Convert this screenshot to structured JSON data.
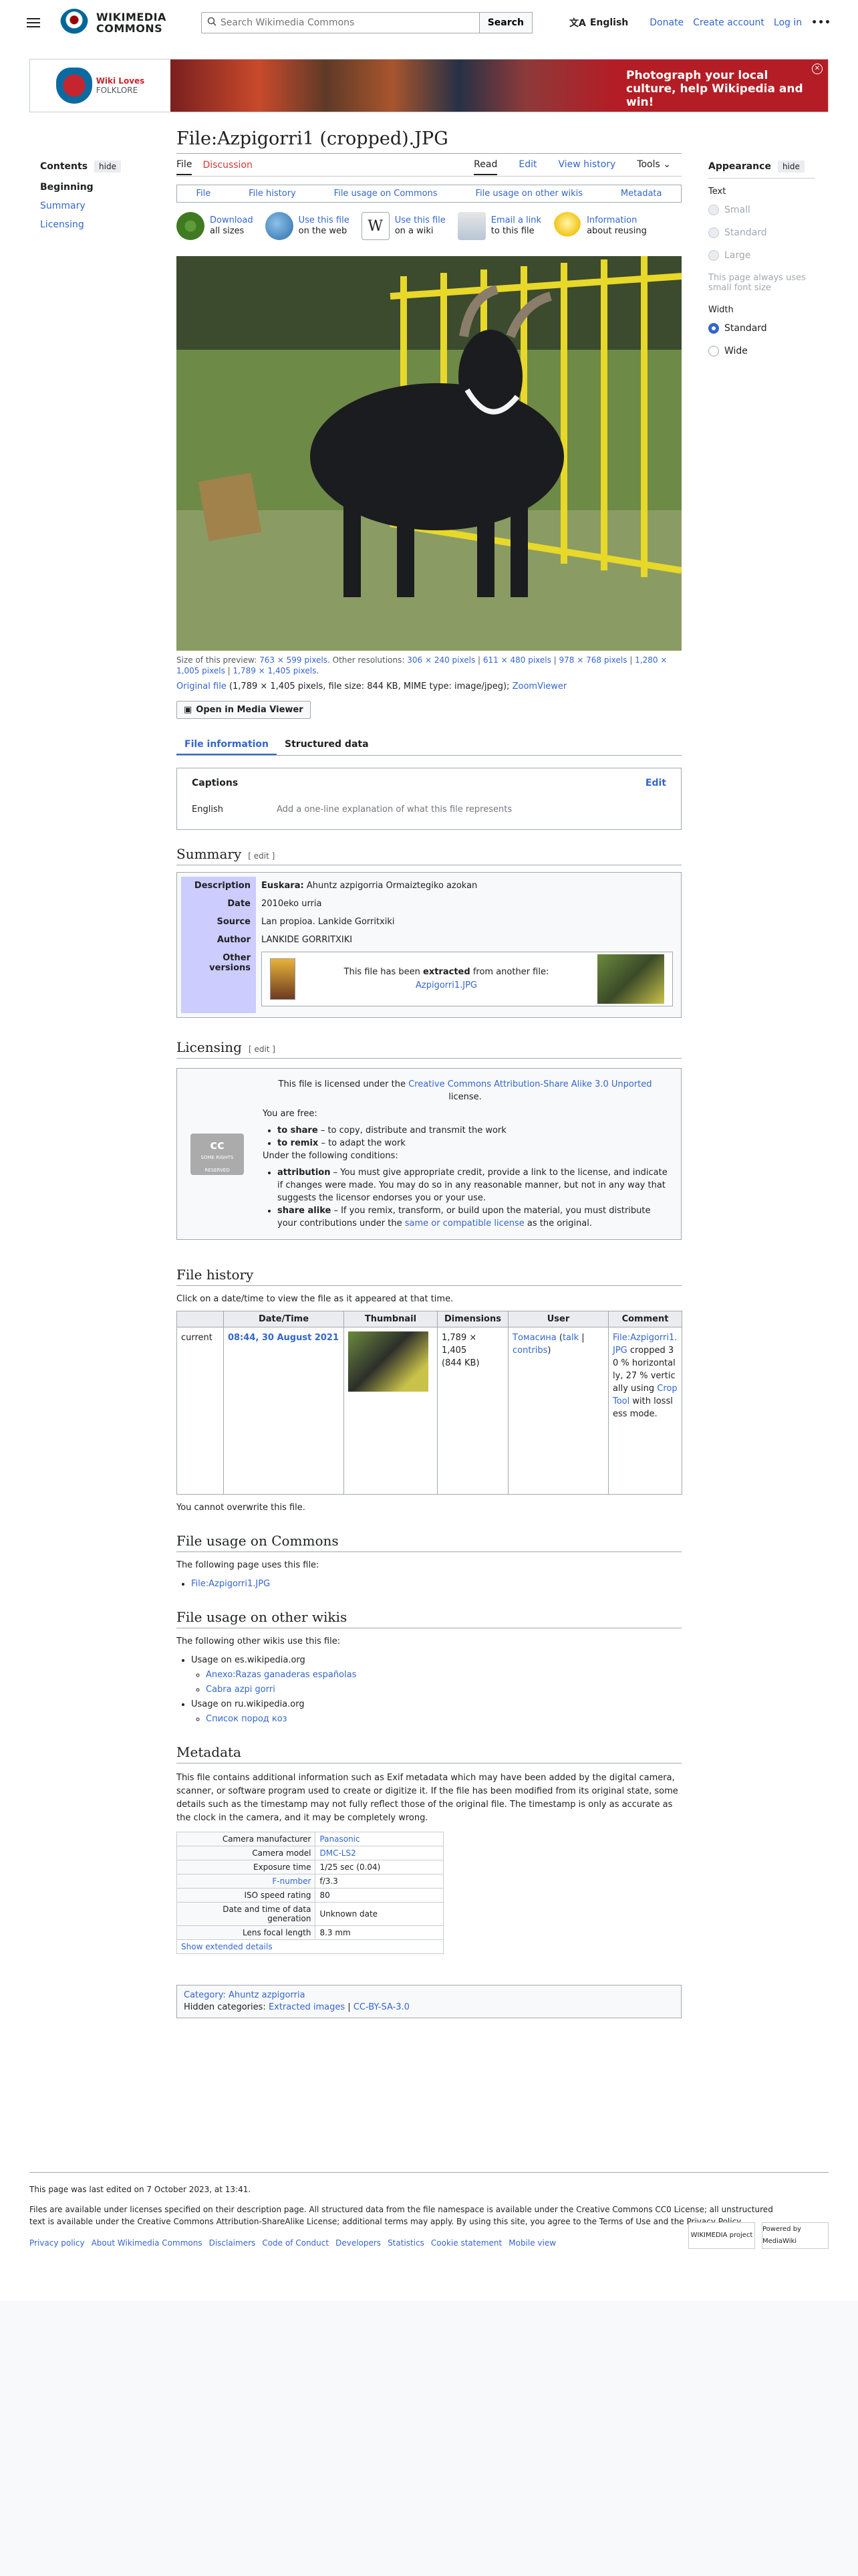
{
  "header": {
    "logo_line1": "WIKIMEDIA",
    "logo_line2": "COMMONS",
    "search_placeholder": "Search Wikimedia Commons",
    "search_button": "Search",
    "language": "English",
    "donate": "Donate",
    "create_account": "Create account",
    "login": "Log in"
  },
  "banner": {
    "logo_line1": "Wiki Loves",
    "logo_line2": "FOLKLORE",
    "cta": "Photograph your local culture, help Wikipedia and win!"
  },
  "toc": {
    "title": "Contents",
    "hide": "hide",
    "items": [
      "Beginning",
      "Summary",
      "Licensing"
    ]
  },
  "appearance": {
    "title": "Appearance",
    "hide": "hide",
    "text_label": "Text",
    "text_options": [
      "Small",
      "Standard",
      "Large"
    ],
    "note": "This page always uses small font size",
    "width_label": "Width",
    "width_options": [
      "Standard",
      "Wide"
    ]
  },
  "page": {
    "title": "File:Azpigorri1 (cropped).JPG",
    "tab_file": "File",
    "tab_discussion": "Discussion",
    "tab_read": "Read",
    "tab_edit": "Edit",
    "tab_history": "View history",
    "tab_tools": "Tools"
  },
  "filetoc": [
    "File",
    "File history",
    "File usage on Commons",
    "File usage on other wikis",
    "Metadata"
  ],
  "actions": [
    {
      "title": "Download",
      "sub": "all sizes"
    },
    {
      "title": "Use this file",
      "sub": "on the web"
    },
    {
      "title": "Use this file",
      "sub": "on a wiki"
    },
    {
      "title": "Email a link",
      "sub": "to this file"
    },
    {
      "title": "Information",
      "sub": "about reusing"
    }
  ],
  "preview": {
    "size_label": "Size of this preview:",
    "size_link": "763 × 599 pixels",
    "other_label": ". Other resolutions:",
    "res1": "306 × 240 pixels",
    "res2": "611 × 480 pixels",
    "res3": "978 × 768 pixels",
    "res4": "1,280 × 1,005 pixels",
    "res5": "1,789 × 1,405 pixels",
    "original_link": "Original file",
    "original_info": "(1,789 × 1,405 pixels, file size: 844 KB, MIME type: image/jpeg);",
    "zoom": "ZoomViewer",
    "media_viewer": "Open in Media Viewer"
  },
  "subtabs": [
    "File information",
    "Structured data"
  ],
  "captions": {
    "title": "Captions",
    "edit": "Edit",
    "lang": "English",
    "placeholder": "Add a one-line explanation of what this file represents"
  },
  "summary": {
    "heading": "Summary",
    "edit": "[ edit ]",
    "desc_label": "Description",
    "desc_lang": "Euskara:",
    "desc_text": "Ahuntz azpigorria Ormaiztegiko azokan",
    "date_label": "Date",
    "date": "2010eko urria",
    "source_label": "Source",
    "source": "Lan propioa. Lankide Gorritxiki",
    "author_label": "Author",
    "author": "LANKIDE GORRITXIKI",
    "versions_label": "Other versions",
    "extracted_pre": "This file has been",
    "extracted_bold": "extracted",
    "extracted_post": "from another file:",
    "extracted_link": "Azpigorri1.JPG"
  },
  "licensing": {
    "heading": "Licensing",
    "edit": "[ edit ]",
    "badge": "cc",
    "badge_sub": "SOME RIGHTS RESERVED",
    "intro_pre": "This file is licensed under the",
    "intro_link": "Creative Commons Attribution-Share Alike 3.0 Unported",
    "intro_post": "license.",
    "free": "You are free:",
    "share_b": "to share",
    "share_t": "– to copy, distribute and transmit the work",
    "remix_b": "to remix",
    "remix_t": "– to adapt the work",
    "conditions": "Under the following conditions:",
    "attr_b": "attribution",
    "attr_t": "– You must give appropriate credit, provide a link to the license, and indicate if changes were made. You may do so in any reasonable manner, but not in any way that suggests the licensor endorses you or your use.",
    "sa_b": "share alike",
    "sa_t": "– If you remix, transform, or build upon the material, you must distribute your contributions under the",
    "sa_link": "same or compatible license",
    "sa_end": "as the original."
  },
  "history": {
    "heading": "File history",
    "intro": "Click on a date/time to view the file as it appeared at that time.",
    "columns": [
      "",
      "Date/Time",
      "Thumbnail",
      "Dimensions",
      "User",
      "Comment"
    ],
    "row": {
      "status": "current",
      "date": "08:44, 30 August 2021",
      "dims": "1,789 × 1,405",
      "size": "(844 KB)",
      "user": "Томасина",
      "talk": "talk",
      "contribs": "contribs",
      "comment_link": "File:Azpigorri1.JPG",
      "comment_mid": "cropped 30 % horizontally, 27 % vertically using",
      "comment_tool": "CropTool",
      "comment_end": "with lossless mode."
    },
    "overwrite": "You cannot overwrite this file."
  },
  "usage_commons": {
    "heading": "File usage on Commons",
    "intro": "The following page uses this file:",
    "items": [
      "File:Azpigorri1.JPG"
    ]
  },
  "usage_other": {
    "heading": "File usage on other wikis",
    "intro": "The following other wikis use this file:",
    "wiki1": "Usage on es.wikipedia.org",
    "wiki1_items": [
      "Anexo:Razas ganaderas españolas",
      "Cabra azpi gorri"
    ],
    "wiki2": "Usage on ru.wikipedia.org",
    "wiki2_items": [
      "Список пород коз"
    ]
  },
  "metadata": {
    "heading": "Metadata",
    "intro": "This file contains additional information such as Exif metadata which may have been added by the digital camera, scanner, or software program used to create or digitize it. If the file has been modified from its original state, some details such as the timestamp may not fully reflect those of the original file. The timestamp is only as accurate as the clock in the camera, and it may be completely wrong.",
    "rows": [
      {
        "k": "Camera manufacturer",
        "v": "Panasonic"
      },
      {
        "k": "Camera model",
        "v": "DMC-LS2"
      },
      {
        "k": "Exposure time",
        "v": "1/25 sec (0.04)"
      },
      {
        "k": "F-number",
        "v": "f/3.3"
      },
      {
        "k": "ISO speed rating",
        "v": "80"
      },
      {
        "k": "Date and time of data generation",
        "v": "Unknown date"
      },
      {
        "k": "Lens focal length",
        "v": "8.3 mm"
      }
    ],
    "extended": "Show extended details"
  },
  "categories": {
    "label": "Category:",
    "cat": "Ahuntz azpigorria",
    "hidden_label": "Hidden categories:",
    "hidden1": "Extracted images",
    "hidden2": "CC-BY-SA-3.0"
  },
  "footer": {
    "edited": "This page was last edited on 7 October 2023, at 13:41.",
    "license_text": "Files are available under licenses specified on their description page. All structured data from the file namespace is available under the Creative Commons CC0 License; all unstructured text is available under the Creative Commons Attribution-ShareAlike License; additional terms may apply. By using this site, you agree to the Terms of Use and the Privacy Policy.",
    "links": [
      "Privacy policy",
      "About Wikimedia Commons",
      "Disclaimers",
      "Code of Conduct",
      "Developers",
      "Statistics",
      "Cookie statement",
      "Mobile view"
    ],
    "badge1": "WIKIMEDIA project",
    "badge2": "Powered by MediaWiki"
  },
  "colors": {
    "link": "#3366cc",
    "banner_red": "#b41d25",
    "label_bg": "#ccccff"
  }
}
